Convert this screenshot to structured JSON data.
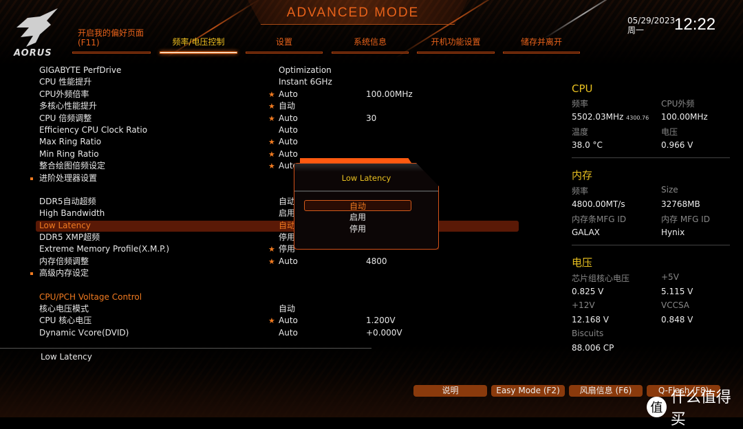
{
  "header": {
    "brand": "AORUS",
    "mode_title": "ADVANCED MODE",
    "date": "05/29/2023",
    "weekday": "周一",
    "time": "12:22"
  },
  "tabs": [
    {
      "label": "开启我的偏好页面",
      "sub": "(F11)"
    },
    {
      "label": "频率/电压控制",
      "active": true
    },
    {
      "label": "设置"
    },
    {
      "label": "系统信息"
    },
    {
      "label": "开机功能设置"
    },
    {
      "label": "储存并离开"
    }
  ],
  "settings": [
    [
      {
        "name": "GIGABYTE PerfDrive",
        "value": "Optimization"
      },
      {
        "name": "CPU 性能提升",
        "value": "Instant 6GHz"
      },
      {
        "name": "CPU外频倍率",
        "star": true,
        "value": "Auto",
        "extra": "100.00MHz"
      },
      {
        "name": "多核心性能提升",
        "star": true,
        "value": "自动"
      },
      {
        "name": "CPU 倍频调整",
        "star": true,
        "value": "Auto",
        "extra": "30"
      },
      {
        "name": "Efficiency CPU Clock Ratio",
        "value": "Auto"
      },
      {
        "name": "Max Ring Ratio",
        "star": true,
        "value": "Auto"
      },
      {
        "name": "Min Ring Ratio",
        "star": true,
        "value": "Auto"
      },
      {
        "name": "整合绘图倍频设定",
        "star": true,
        "value": "Auto"
      },
      {
        "name": "进阶处理器设置",
        "submenu": true
      }
    ],
    [
      {
        "name": "DDR5自动超频",
        "value": "自动"
      },
      {
        "name": "High Bandwidth",
        "value": "启用"
      },
      {
        "name": "Low Latency",
        "value": "自动",
        "selected": true
      },
      {
        "name": "DDR5 XMP超频",
        "value": "停用"
      },
      {
        "name": "Extreme Memory Profile(X.M.P.)",
        "star": true,
        "value": "停用"
      },
      {
        "name": "内存倍频调整",
        "star": true,
        "value": "Auto",
        "extra": "4800"
      },
      {
        "name": "高级内存设定",
        "submenu": true
      }
    ],
    [
      {
        "name": "CPU/PCH Voltage Control",
        "header": true
      },
      {
        "name": "核心电压模式",
        "value": "自动"
      },
      {
        "name": "CPU 核心电压",
        "star": true,
        "value": "Auto",
        "extra": "1.200V"
      },
      {
        "name": "Dynamic Vcore(DVID)",
        "value": "Auto",
        "extra": "+0.000V"
      }
    ]
  ],
  "help_text": "Low Latency",
  "dialog": {
    "title": "Low Latency",
    "options": [
      "自动",
      "启用",
      "停用"
    ],
    "selected_index": 0
  },
  "panel": [
    {
      "title": "CPU",
      "items": [
        {
          "label": "频率",
          "value": "5502.03MHz",
          "small": "4300.76"
        },
        {
          "label": "CPU外频",
          "value": "100.00MHz"
        },
        {
          "label": "温度",
          "value": " 38.0 °C"
        },
        {
          "label": "电压",
          "value": " 0.966 V"
        }
      ]
    },
    {
      "title": "内存",
      "items": [
        {
          "label": "频率",
          "value": "4800.00MT/s"
        },
        {
          "label": "Size",
          "value": "32768MB"
        },
        {
          "label": "内存条MFG ID",
          "value": "GALAX"
        },
        {
          "label": "内存 MFG ID",
          "value": "Hynix"
        }
      ]
    },
    {
      "title": "电压",
      "items": [
        {
          "label": "芯片组核心电压",
          "value": " 0.825 V"
        },
        {
          "label": "+5V",
          "value": " 5.115 V"
        },
        {
          "label": "+12V",
          "value": "12.168 V"
        },
        {
          "label": "VCCSA",
          "value": " 0.848 V"
        },
        {
          "label": "Biscuits",
          "value": "88.006 CP"
        }
      ]
    }
  ],
  "buttons": [
    "说明",
    "Easy Mode (F2)",
    "风扇信息 (F6)",
    "Q-Flash (F8)"
  ],
  "watermark": {
    "badge": "值",
    "text": "什么值得买"
  },
  "colors": {
    "accent": "#e8621a",
    "highlight": "#5a1906",
    "title_yellow": "#e8c020",
    "button": "#8a3a0c"
  }
}
